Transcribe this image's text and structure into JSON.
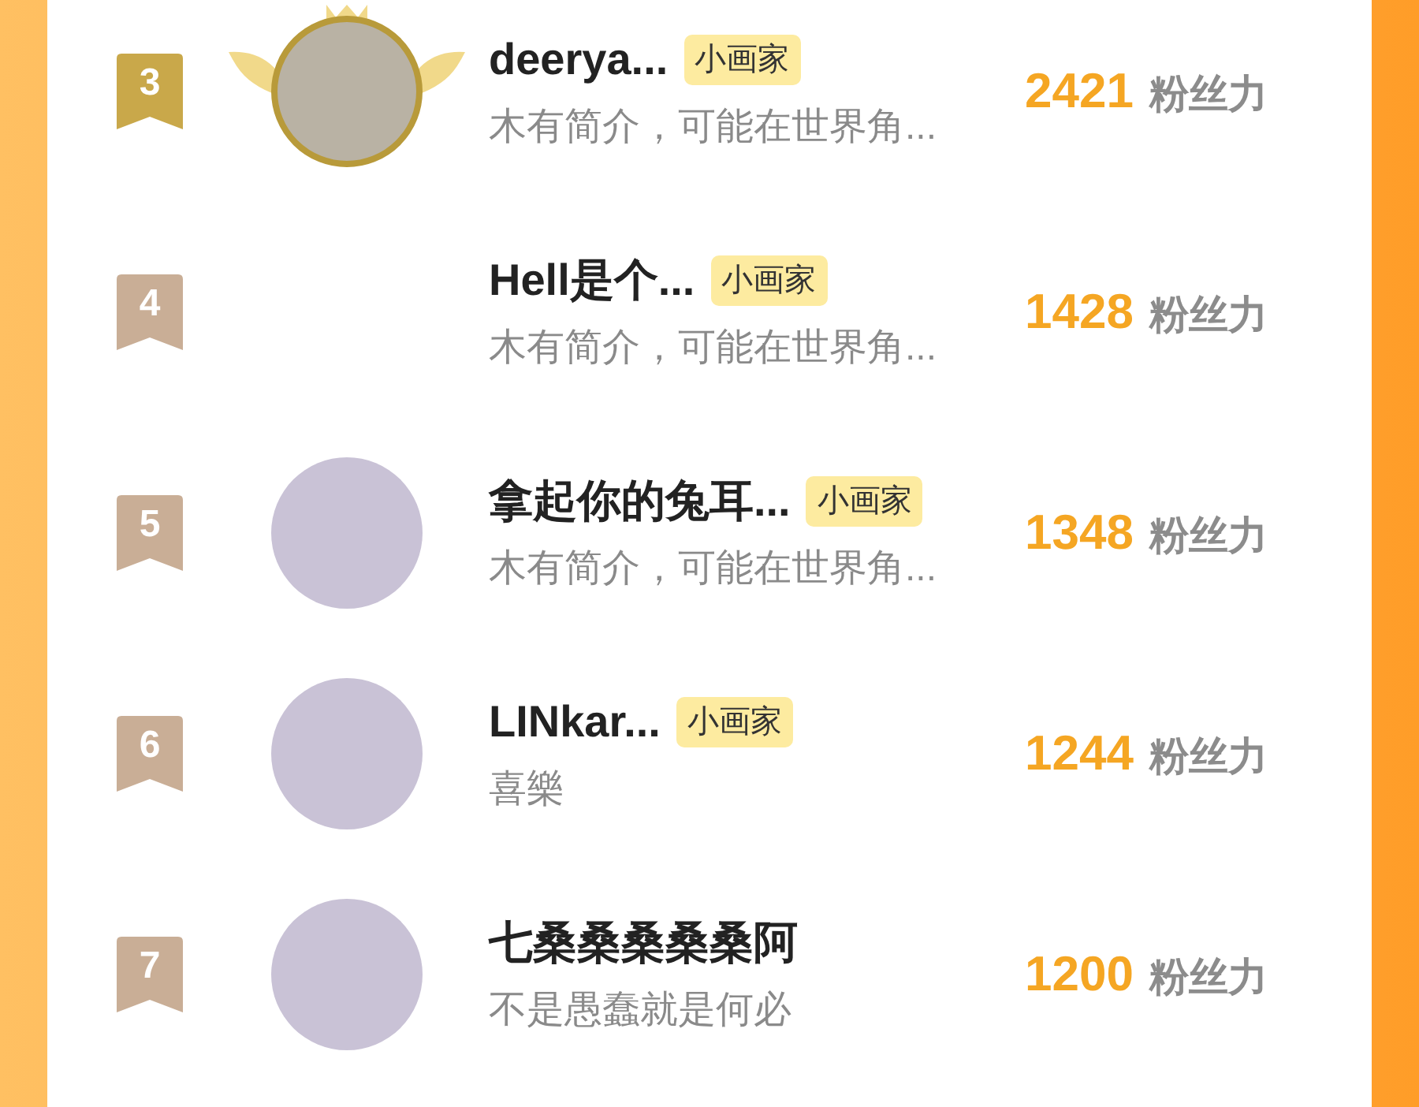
{
  "rows": [
    {
      "rank": "3",
      "color": "#c9a84a",
      "avatar": true,
      "crown": true,
      "name": "deerya...",
      "tag": "小画家",
      "bio": "木有简介，可能在世界角...",
      "score": "2421",
      "unit": "粉丝力"
    },
    {
      "rank": "4",
      "color": "#c9ae96",
      "avatar": false,
      "crown": false,
      "name": "Hell是个...",
      "tag": "小画家",
      "bio": "木有简介，可能在世界角...",
      "score": "1428",
      "unit": "粉丝力"
    },
    {
      "rank": "5",
      "color": "#c9ae96",
      "avatar": true,
      "crown": false,
      "name": "拿起你的兔耳...",
      "tag": "小画家",
      "bio": "木有简介，可能在世界角...",
      "score": "1348",
      "unit": "粉丝力"
    },
    {
      "rank": "6",
      "color": "#c9ae96",
      "avatar": true,
      "crown": false,
      "name": "LINkar...",
      "tag": "小画家",
      "bio": "喜樂",
      "score": "1244",
      "unit": "粉丝力"
    },
    {
      "rank": "7",
      "color": "#c9ae96",
      "avatar": true,
      "crown": false,
      "name": "七桑桑桑桑桑阿",
      "bio": "不是愚蠢就是何必",
      "score": "1200",
      "unit": "粉丝力"
    }
  ]
}
